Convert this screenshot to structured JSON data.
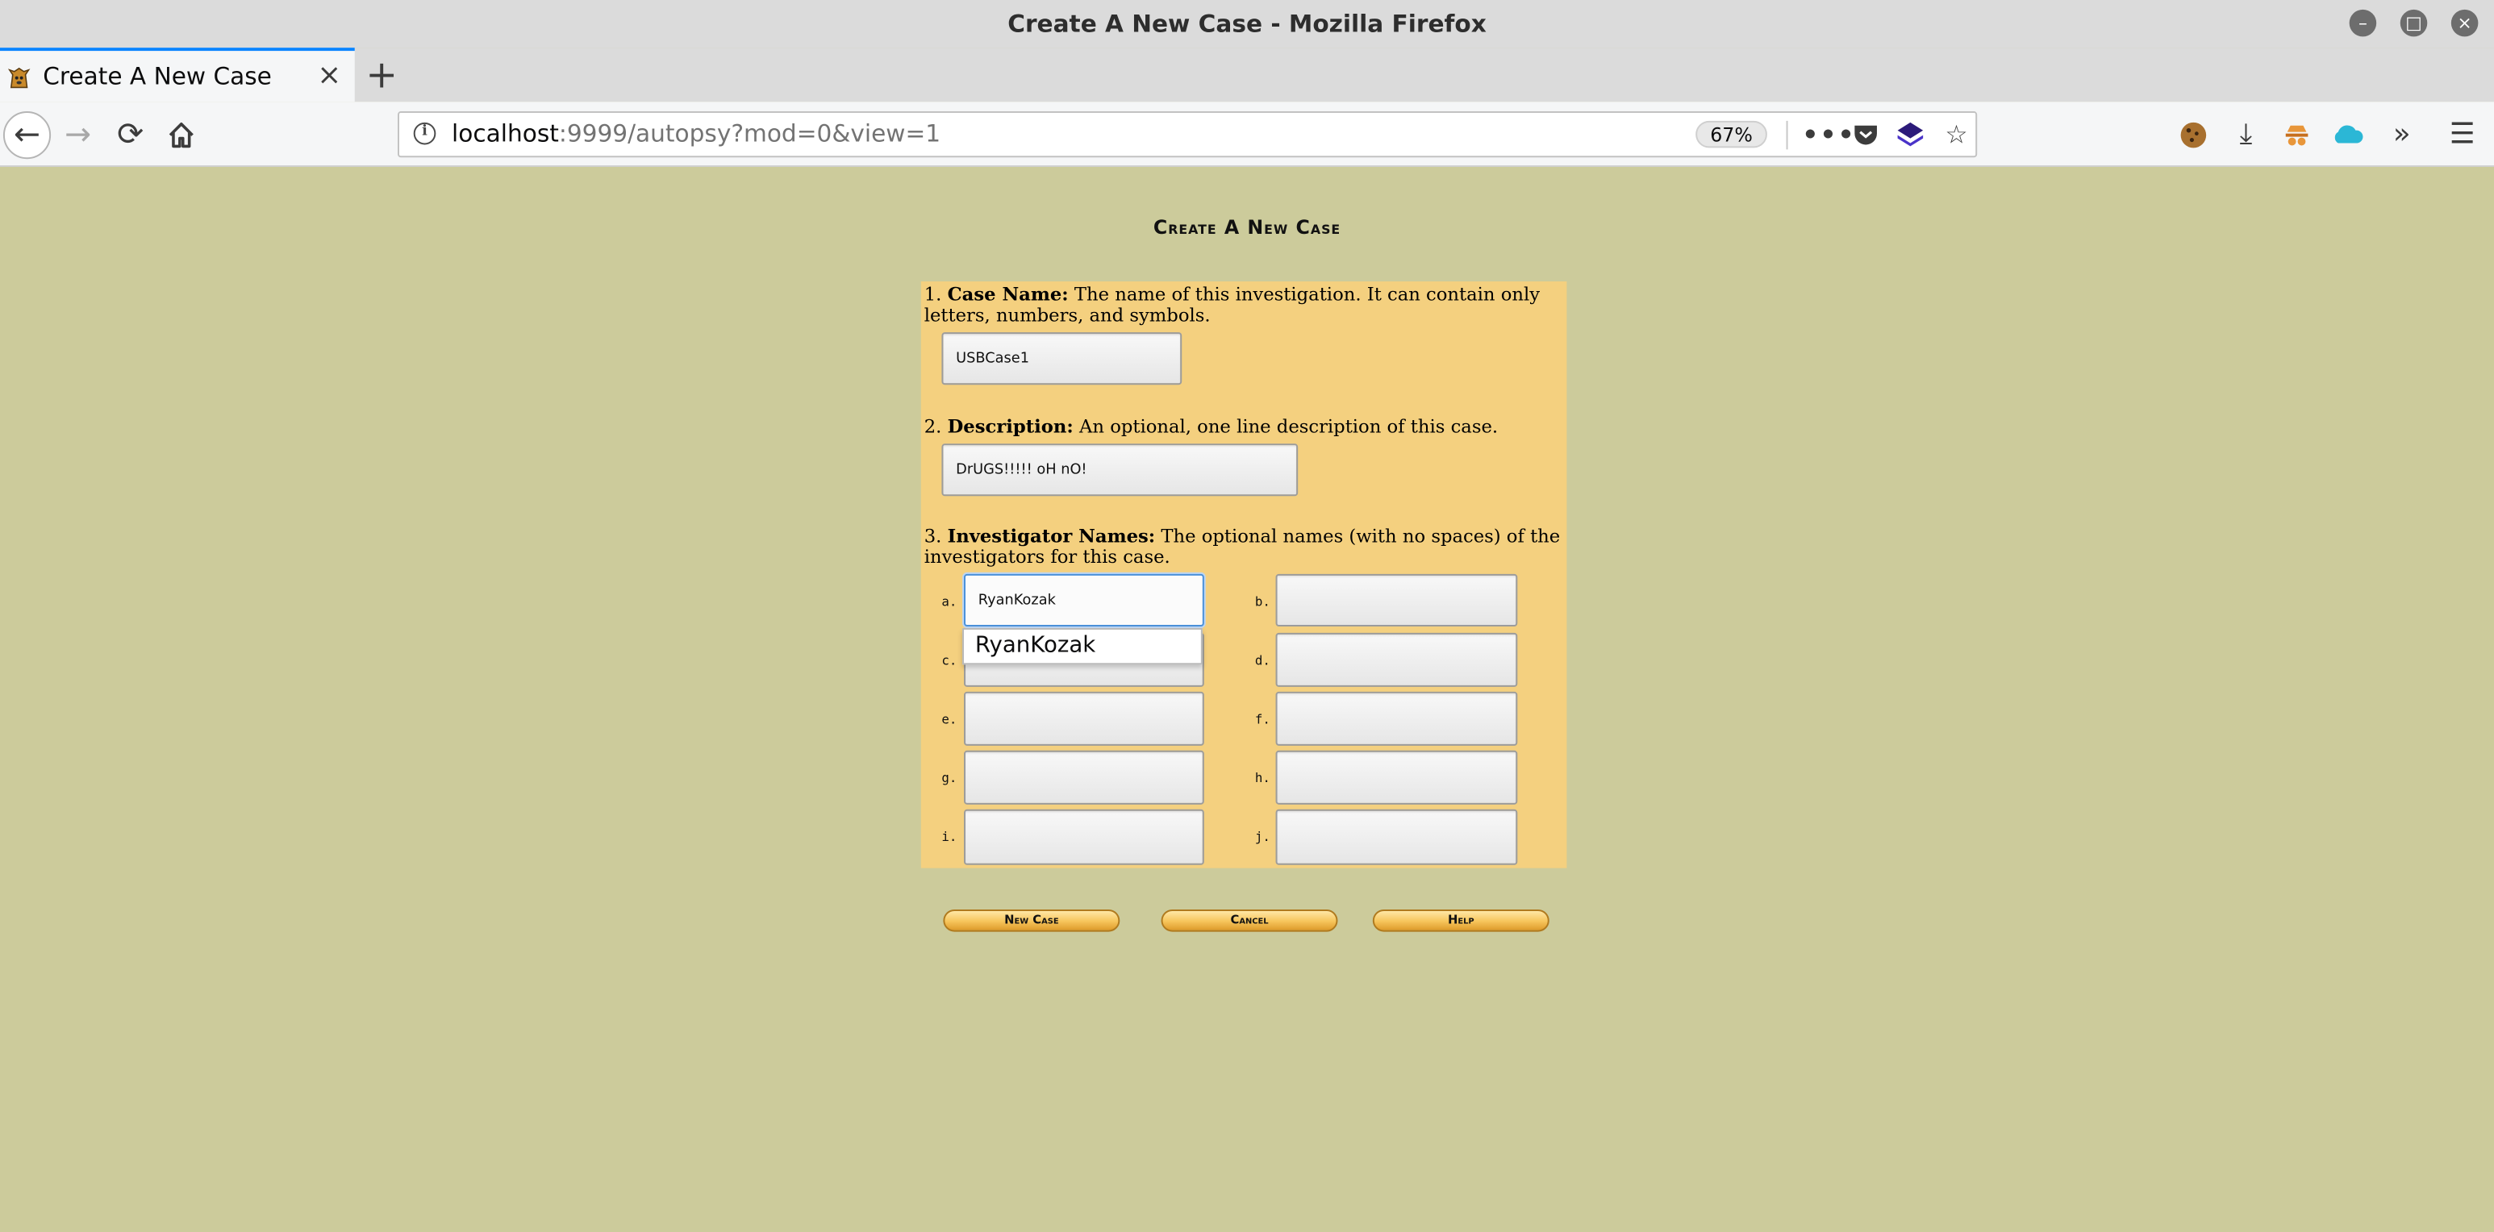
{
  "window": {
    "title": "Create A New Case - Mozilla Firefox",
    "controls": [
      "minimize-icon",
      "maximize-icon",
      "close-icon"
    ]
  },
  "tabs": [
    {
      "title": "Create A New Case",
      "favicon": "autopsy-dog-icon",
      "active": true
    }
  ],
  "navbar": {
    "url_host": "localhost",
    "url_rest": ":9999/autopsy?mod=0&view=1",
    "zoom": "67%",
    "toolbar_icons": [
      "cookie-icon",
      "download-icon",
      "extension-icon",
      "cloud-icon",
      "overflow-chevron-icon",
      "menu-icon"
    ]
  },
  "page": {
    "title": "Create A New Case",
    "q1": {
      "num": "1.",
      "label": "Case Name:",
      "desc": " The name of this investigation. It can contain only letters, numbers, and symbols.",
      "value": "USBCase1"
    },
    "q2": {
      "num": "2.",
      "label": "Description:",
      "desc": " An optional, one line description of this case.",
      "value": "DrUGS!!!!! oH nO!"
    },
    "q3": {
      "num": "3.",
      "label": "Investigator Names:",
      "desc": " The optional names (with no spaces) of the investigators for this case.",
      "investigators": [
        {
          "letter": "a.",
          "value": "RyanKozak"
        },
        {
          "letter": "b.",
          "value": ""
        },
        {
          "letter": "c.",
          "value": ""
        },
        {
          "letter": "d.",
          "value": ""
        },
        {
          "letter": "e.",
          "value": ""
        },
        {
          "letter": "f.",
          "value": ""
        },
        {
          "letter": "g.",
          "value": ""
        },
        {
          "letter": "h.",
          "value": ""
        },
        {
          "letter": "i.",
          "value": ""
        },
        {
          "letter": "j.",
          "value": ""
        }
      ]
    },
    "autocomplete_suggestion": "RyanKozak",
    "buttons": {
      "new_case": "New Case",
      "cancel": "Cancel",
      "help": "Help"
    }
  },
  "colors": {
    "page_bg": "#cccb9b",
    "form_bg": "#f4d07f",
    "button_orange": "#f6c45a"
  }
}
